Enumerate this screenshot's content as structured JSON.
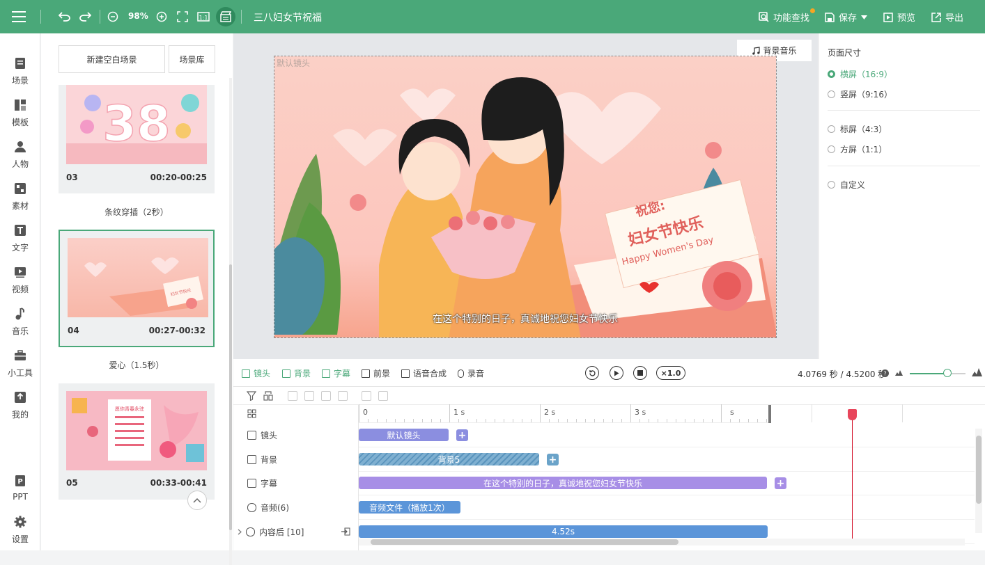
{
  "topbar": {
    "zoom": "98%",
    "title": "三八妇女节祝福",
    "find_label": "功能查找",
    "save_label": "保存",
    "preview_label": "预览",
    "export_label": "导出",
    "colors": {
      "bar": "#4aa879",
      "notif": "#f5a623"
    }
  },
  "nav": [
    {
      "label": "场景",
      "icon": "scene-icon"
    },
    {
      "label": "模板",
      "icon": "template-icon"
    },
    {
      "label": "人物",
      "icon": "person-icon"
    },
    {
      "label": "素材",
      "icon": "material-icon"
    },
    {
      "label": "文字",
      "icon": "text-icon"
    },
    {
      "label": "视频",
      "icon": "video-icon"
    },
    {
      "label": "音乐",
      "icon": "music-icon"
    },
    {
      "label": "小工具",
      "icon": "toolbox-icon"
    },
    {
      "label": "我的",
      "icon": "my-upload-icon"
    },
    {
      "label": "PPT",
      "icon": "ppt-icon"
    },
    {
      "label": "设置",
      "icon": "settings-icon"
    }
  ],
  "scenes": {
    "new_blank": "新建空白场景",
    "library": "场景库",
    "items": [
      {
        "num": "03",
        "time": "00:20-00:25",
        "thumb_text": "38"
      },
      {
        "num": "04",
        "time": "00:27-00:32",
        "thumb_text": "妇女节快乐"
      },
      {
        "num": "05",
        "time": "00:33-00:41",
        "thumb_text": "愿你青春永驻"
      }
    ],
    "transitions": [
      "条纹穿插（2秒）",
      "爱心（1.5秒）"
    ]
  },
  "stage": {
    "camera_label": "默认镜头",
    "bgm_label": "背景音乐",
    "subtitle": "在这个特别的日子，真诚地祝您妇女节快乐",
    "card_line1": "祝您:",
    "card_line2": "妇女节快乐",
    "card_line3": "Happy Women's Day"
  },
  "props": {
    "title": "页面尺寸",
    "options": [
      {
        "label": "横屏（16:9）",
        "checked": true
      },
      {
        "label": "竖屏（9:16）",
        "checked": false
      },
      {
        "label": "标屏（4:3）",
        "checked": false
      },
      {
        "label": "方屏（1:1）",
        "checked": false
      },
      {
        "label": "自定义",
        "checked": false
      }
    ]
  },
  "timeline_toolbar": {
    "tabs": [
      "镜头",
      "背景",
      "字幕",
      "前景",
      "语音合成",
      "录音"
    ],
    "speed": "×1.0",
    "time": "4.0769 秒 / 4.5200 秒"
  },
  "timeline": {
    "ruler": [
      "0",
      "1 s",
      "2 s",
      "3 s",
      "s"
    ],
    "tracks": [
      {
        "label": "镜头",
        "clip": "默认镜头",
        "color": "#8b8ee0"
      },
      {
        "label": "背景",
        "clip": "背景5",
        "color": "#6aa3c9"
      },
      {
        "label": "字幕",
        "clip": "在这个特别的日子，真诚地祝您妇女节快乐",
        "color": "#a78ee6"
      },
      {
        "label": "音频(6)",
        "clip": "音频文件（播放1次）",
        "color": "#5b95d9"
      },
      {
        "label": "内容后 [10]",
        "clip": "4.52s",
        "color": "#5b95d9"
      }
    ]
  }
}
